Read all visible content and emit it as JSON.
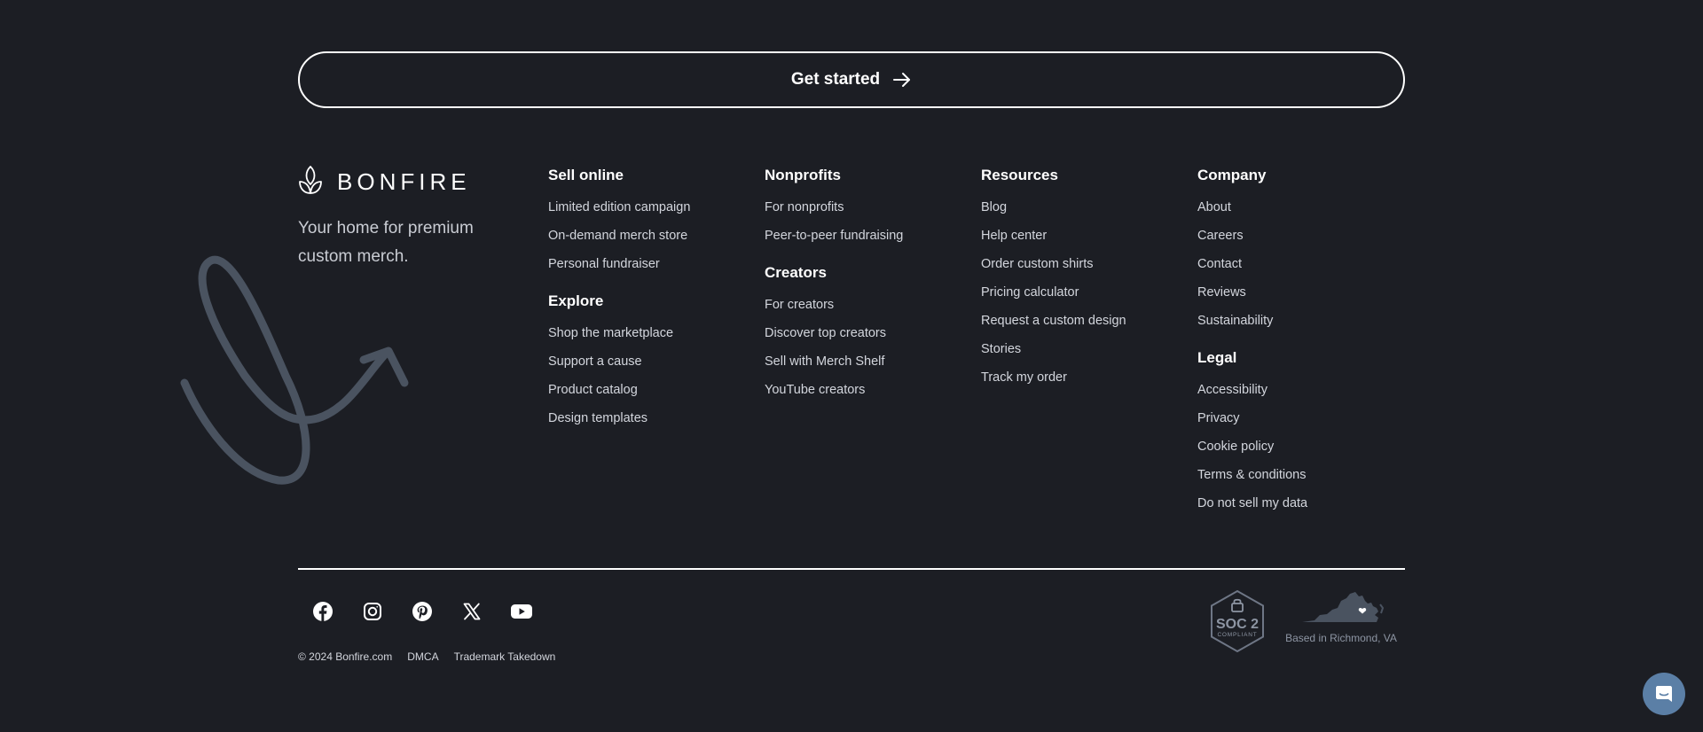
{
  "cta": {
    "label": "Get started",
    "icon": "arrow-right-icon"
  },
  "brand": {
    "name": "BONFIRE",
    "logo_icon": "bonfire-leaf-icon",
    "tagline": "Your home for premium custom merch."
  },
  "columns": [
    {
      "groups": [
        {
          "title": "Sell online",
          "links": [
            "Limited edition campaign",
            "On-demand merch store",
            "Personal fundraiser"
          ]
        },
        {
          "title": "Explore",
          "links": [
            "Shop the marketplace",
            "Support a cause",
            "Product catalog",
            "Design templates"
          ]
        }
      ]
    },
    {
      "groups": [
        {
          "title": "Nonprofits",
          "links": [
            "For nonprofits",
            "Peer-to-peer fundraising"
          ]
        },
        {
          "title": "Creators",
          "links": [
            "For creators",
            "Discover top creators",
            "Sell with Merch Shelf",
            "YouTube creators"
          ]
        }
      ]
    },
    {
      "groups": [
        {
          "title": "Resources",
          "links": [
            "Blog",
            "Help center",
            "Order custom shirts",
            "Pricing calculator",
            "Request a custom design",
            "Stories",
            "Track my order"
          ]
        }
      ]
    },
    {
      "groups": [
        {
          "title": "Company",
          "links": [
            "About",
            "Careers",
            "Contact",
            "Reviews",
            "Sustainability"
          ]
        },
        {
          "title": "Legal",
          "links": [
            "Accessibility",
            "Privacy",
            "Cookie policy",
            "Terms & conditions",
            "Do not sell my data"
          ]
        }
      ]
    }
  ],
  "socials": [
    "facebook-icon",
    "instagram-icon",
    "pinterest-icon",
    "x-icon",
    "youtube-icon"
  ],
  "legal": {
    "copyright": "© 2024 Bonfire.com",
    "dmca": "DMCA",
    "trademark": "Trademark Takedown"
  },
  "badges": {
    "soc_main": "SOC 2",
    "soc_sub": "COMPLIANT",
    "location": "Based in Richmond, VA"
  },
  "chat": {
    "icon": "chat-bubble-icon"
  },
  "colors": {
    "background": "#1c1e24",
    "text": "#ffffff",
    "link": "#d3d6dd",
    "muted": "#8d95a3",
    "squiggle": "#4a5360",
    "chat": "#5b7fa6"
  }
}
